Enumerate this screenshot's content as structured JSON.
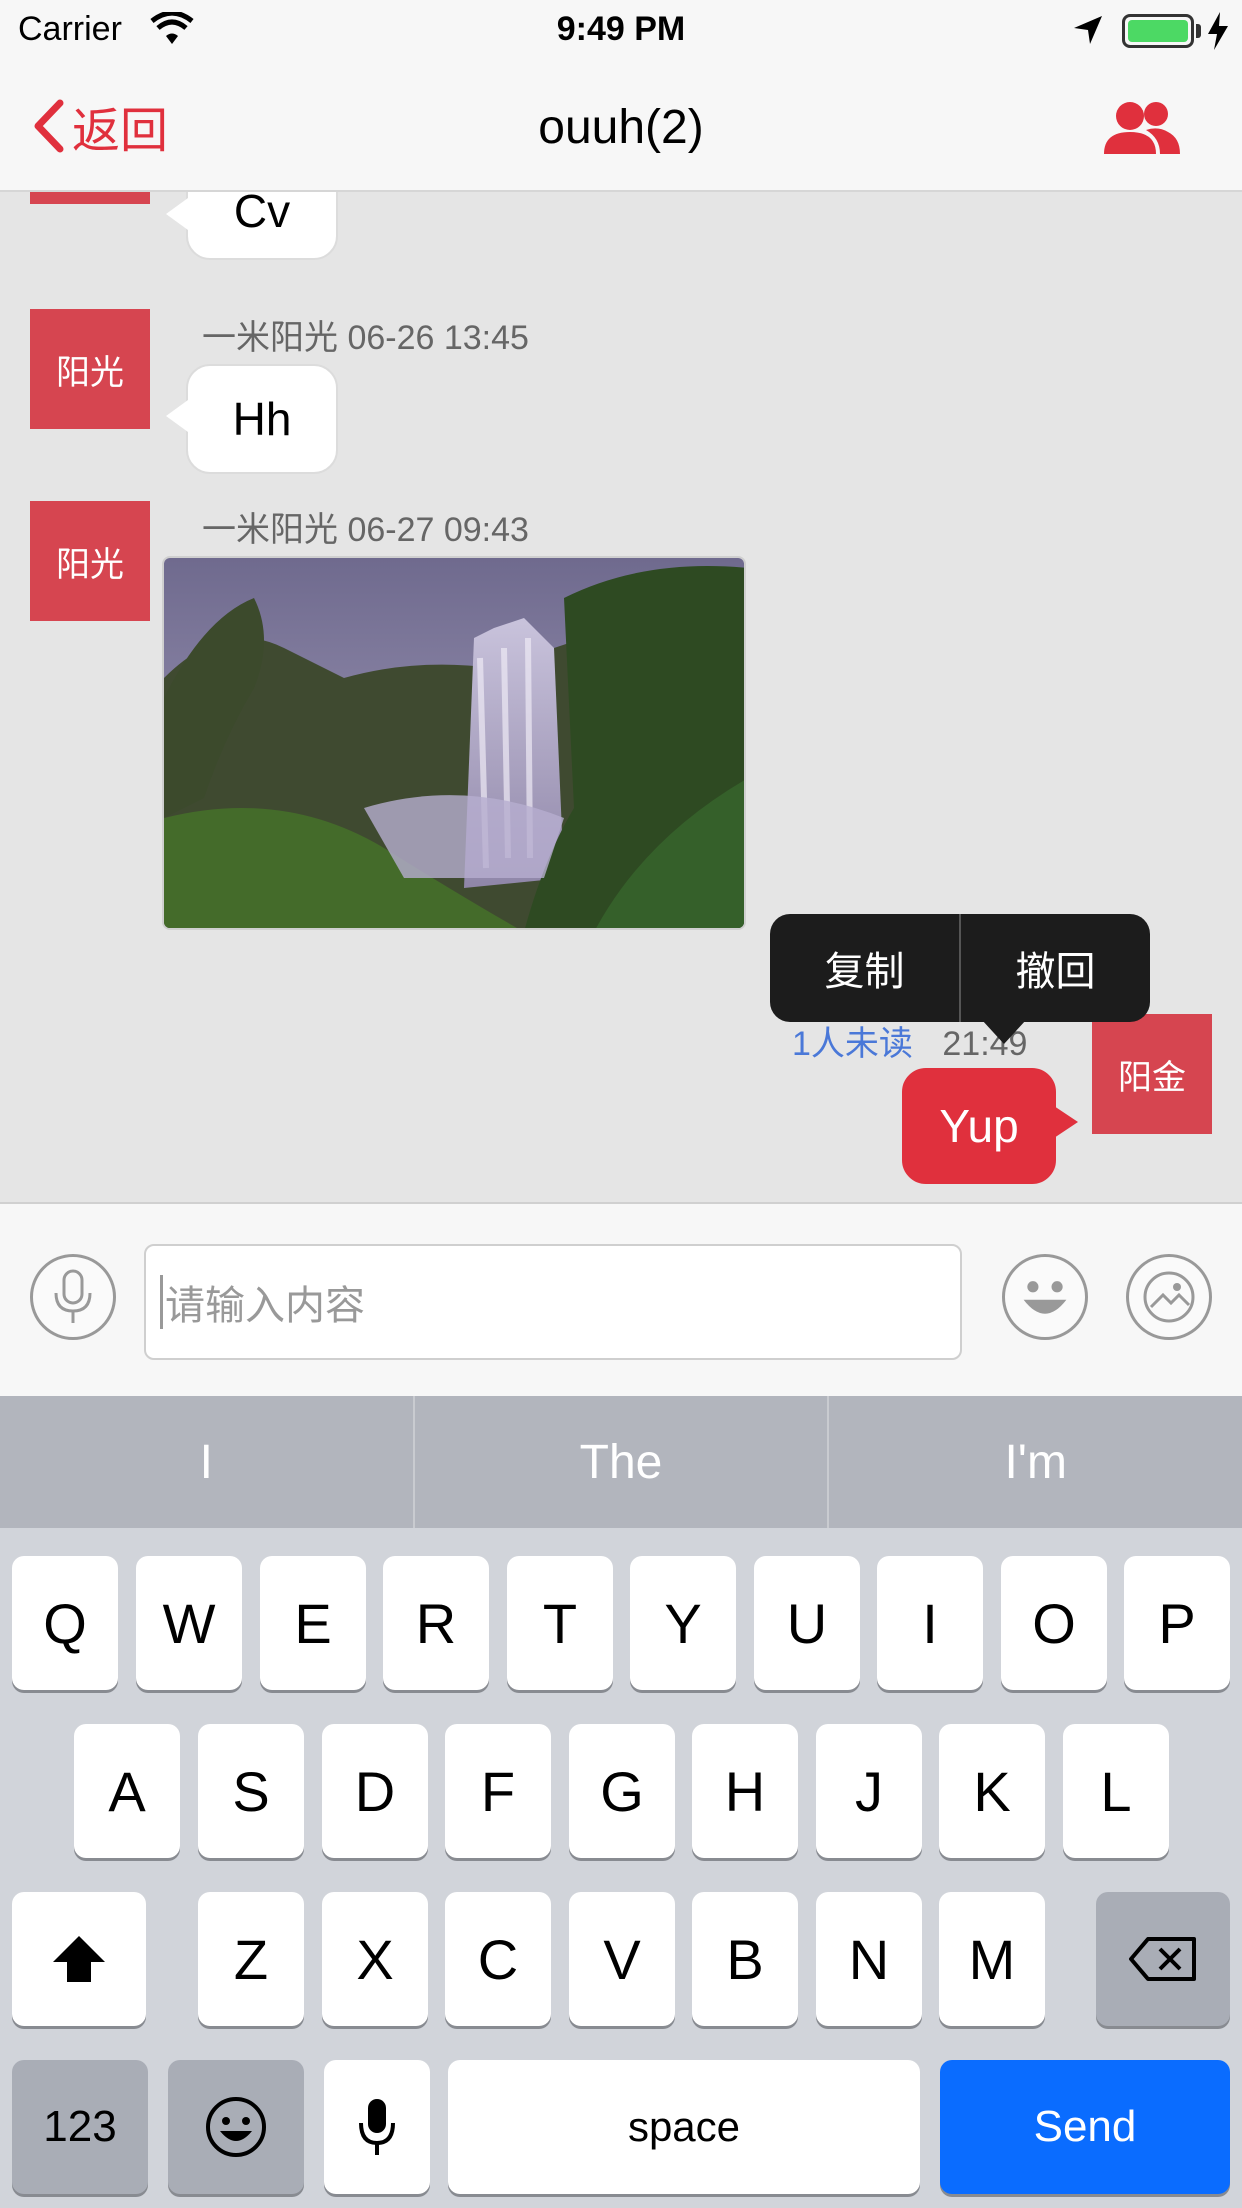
{
  "status_bar": {
    "carrier": "Carrier",
    "time": "9:49 PM",
    "battery_color": "#4cd964"
  },
  "nav": {
    "back_label": "返回",
    "title": "ouuh(2)",
    "accent": "#e0303d"
  },
  "messages": {
    "m0": {
      "text": "Cv"
    },
    "m1": {
      "avatar": "阳光",
      "meta": "一米阳光 06-26 13:45",
      "text": "Hh"
    },
    "m2": {
      "avatar": "阳光",
      "meta": "一米阳光 06-27 09:43"
    },
    "m3": {
      "avatar": "阳金",
      "unread": "1人未读",
      "time": "21:49",
      "text": "Yup"
    }
  },
  "popup": {
    "copy_label": "复制",
    "recall_label": "撤回"
  },
  "composer": {
    "placeholder": "请输入内容"
  },
  "keyboard": {
    "suggestions": [
      "I",
      "The",
      "I'm"
    ],
    "row1": [
      "Q",
      "W",
      "E",
      "R",
      "T",
      "Y",
      "U",
      "I",
      "O",
      "P"
    ],
    "row2": [
      "A",
      "S",
      "D",
      "F",
      "G",
      "H",
      "J",
      "K",
      "L"
    ],
    "row3": [
      "Z",
      "X",
      "C",
      "V",
      "B",
      "N",
      "M"
    ],
    "numbers_label": "123",
    "space_label": "space",
    "send_label": "Send",
    "send_color": "#0a6cff"
  }
}
